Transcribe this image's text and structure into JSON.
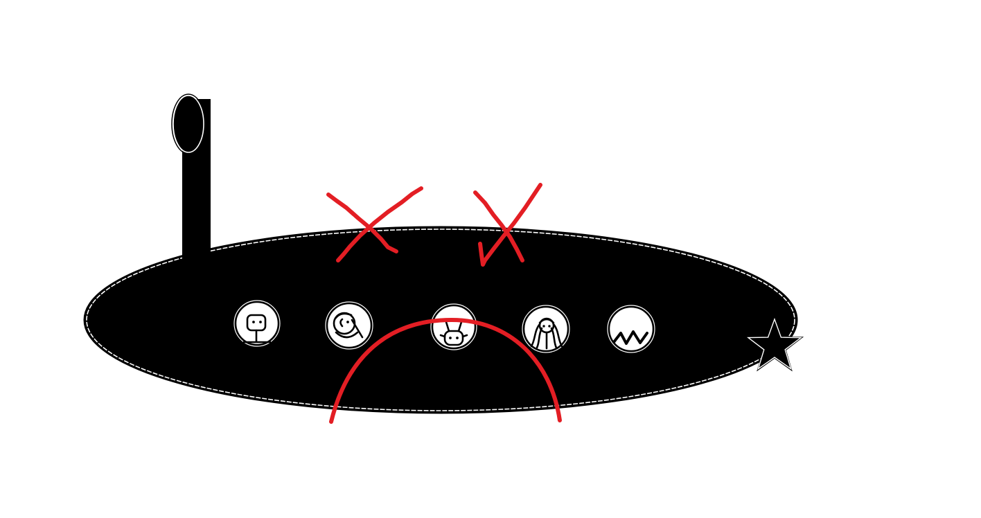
{
  "colors": {
    "background": "#ffffff",
    "hull": "#000000",
    "porthole": "#ffffff",
    "marks": "#e31e24"
  },
  "submarine": {
    "periscope_icon": "periscope-lens-icon",
    "portholes": [
      {
        "icon": "robot-face-icon"
      },
      {
        "icon": "smiling-face-icon"
      },
      {
        "icon": "antenna-creature-icon"
      },
      {
        "icon": "long-hair-girl-icon"
      },
      {
        "icon": "mountain-icon"
      }
    ],
    "tail_icon": "star-icon"
  },
  "annotations": [
    {
      "icon": "cross-mark-icon"
    },
    {
      "icon": "check-cross-mark-icon"
    },
    {
      "icon": "frown-arc-icon"
    }
  ]
}
